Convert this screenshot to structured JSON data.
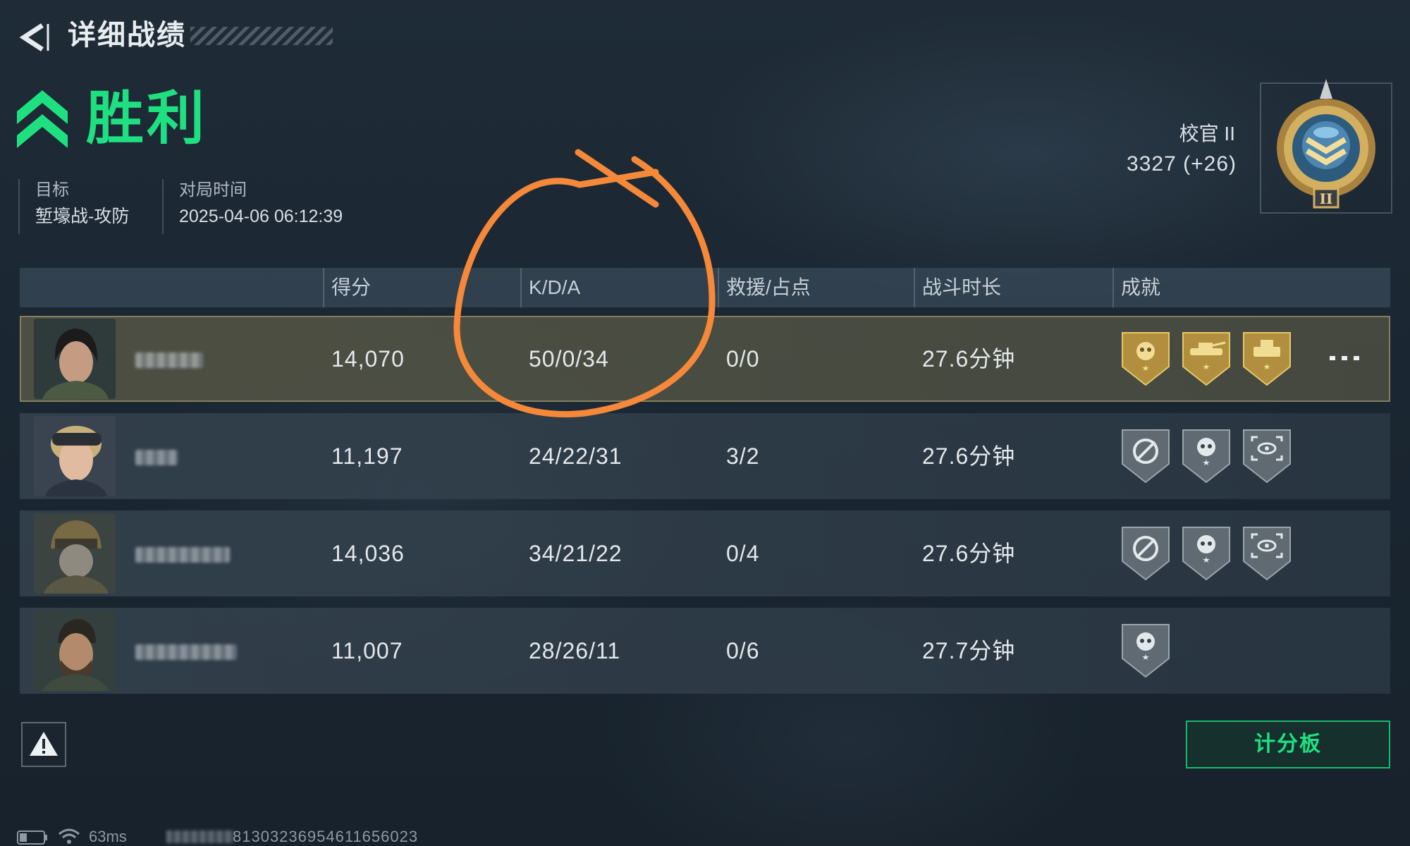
{
  "header": {
    "back_label": "<",
    "title": "详细战绩"
  },
  "result": {
    "label": "胜利",
    "color": "#1fe081"
  },
  "match_info": {
    "mode_label": "目标",
    "mode_value": "堑壕战-攻防",
    "time_label": "对局时间",
    "time_value": "2025-04-06 06:12:39"
  },
  "rank": {
    "name": "校官 II",
    "points": "3327 (+26)",
    "badge_icon": "rank-emblem-icon"
  },
  "table": {
    "columns": [
      "得分",
      "K/D/A",
      "救援/占点",
      "战斗时长",
      "成就"
    ],
    "rows": [
      {
        "name_hidden": true,
        "score": "14,070",
        "kda": "50/0/34",
        "rescue_capture": "0/0",
        "duration": "27.6分钟",
        "achievements": [
          "gold-skull-rose-badge",
          "gold-tank-badge",
          "gold-vehicle-badge"
        ],
        "highlighted": true,
        "more": "•••"
      },
      {
        "name_hidden": true,
        "score": "11,197",
        "kda": "24/22/31",
        "rescue_capture": "3/2",
        "duration": "27.6分钟",
        "achievements": [
          "silver-crosshair-badge",
          "silver-skull-badge",
          "silver-scope-badge"
        ]
      },
      {
        "name_hidden": true,
        "score": "14,036",
        "kda": "34/21/22",
        "rescue_capture": "0/4",
        "duration": "27.6分钟",
        "achievements": [
          "silver-crosshair-badge",
          "silver-skull-badge",
          "silver-scope-badge"
        ]
      },
      {
        "name_hidden": true,
        "score": "11,007",
        "kda": "28/26/11",
        "rescue_capture": "0/6",
        "duration": "27.7分钟",
        "achievements": [
          "silver-skull-badge"
        ]
      }
    ]
  },
  "footer": {
    "scoreboard_label": "计分板",
    "ping": "63ms",
    "match_id": "81303236954611656023"
  },
  "colors": {
    "accent_green": "#1fe081",
    "annotation_orange": "#f6883a",
    "gold_badge": "#c8a848",
    "silver_badge": "#7d878f"
  }
}
